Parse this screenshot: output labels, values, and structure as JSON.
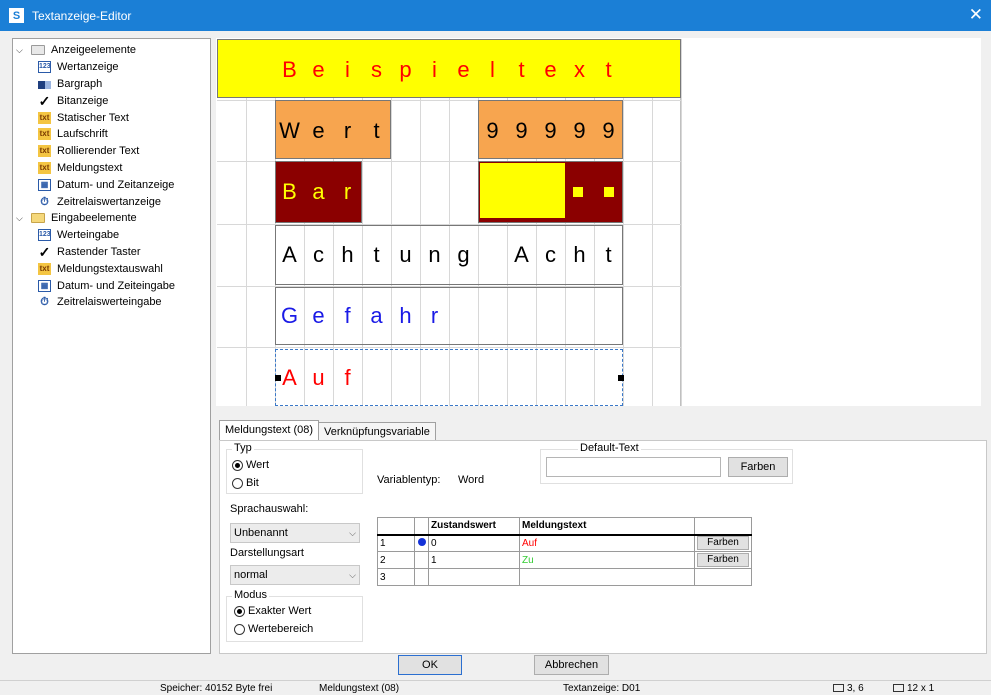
{
  "window": {
    "title": "Textanzeige-Editor",
    "app_icon_letter": "S"
  },
  "tree": {
    "groups": [
      {
        "label": "Anzeigeelemente",
        "items": [
          {
            "label": "Wertanzeige",
            "icon": "value-display-icon"
          },
          {
            "label": "Bargraph",
            "icon": "bargraph-icon"
          },
          {
            "label": "Bitanzeige",
            "icon": "checkmark-icon"
          },
          {
            "label": "Statischer Text",
            "icon": "txt-icon"
          },
          {
            "label": "Laufschrift",
            "icon": "txt-scroll-icon"
          },
          {
            "label": "Rollierender Text",
            "icon": "txt-rolling-icon"
          },
          {
            "label": "Meldungstext",
            "icon": "txt-message-icon"
          },
          {
            "label": "Datum- und Zeitanzeige",
            "icon": "calendar-icon"
          },
          {
            "label": "Zeitrelaiswertanzeige",
            "icon": "timer-icon"
          }
        ]
      },
      {
        "label": "Eingabeelemente",
        "items": [
          {
            "label": "Werteingabe",
            "icon": "value-input-icon"
          },
          {
            "label": "Rastender Taster",
            "icon": "check-input-icon"
          },
          {
            "label": "Meldungstextauswahl",
            "icon": "txt-select-icon"
          },
          {
            "label": "Datum- und Zeiteingabe",
            "icon": "calendar-input-icon"
          },
          {
            "label": "Zeitrelaiswerteingabe",
            "icon": "timer-input-icon"
          }
        ]
      }
    ]
  },
  "preview": {
    "colors": {
      "yellow": "#ffff00",
      "orange": "#f7a54f",
      "darkred": "#8b0000",
      "red": "#ff0000",
      "blue": "#1a1ae6"
    },
    "row1_chars": [
      "B",
      "e",
      "i",
      "s",
      "p",
      "i",
      "e",
      "l",
      "t",
      "e",
      "x",
      "t"
    ],
    "row2_chars_a": [
      "W",
      "e",
      "r",
      "t"
    ],
    "row2_chars_b": [
      "9",
      "9",
      "9",
      "9",
      "9"
    ],
    "row3_chars": [
      "B",
      "a",
      "r"
    ],
    "row4_chars": [
      "A",
      "c",
      "h",
      "t",
      "u",
      "n",
      "g",
      " ",
      "A",
      "c",
      "h",
      "t"
    ],
    "row5_chars": [
      "G",
      "e",
      "f",
      "a",
      "h",
      "r"
    ],
    "row6_chars": [
      "A",
      "u",
      "f"
    ]
  },
  "tabs": [
    {
      "label": "Meldungstext (08)",
      "active": true
    },
    {
      "label": "Verknüpfungsvariable",
      "active": false
    }
  ],
  "form": {
    "typ_label": "Typ",
    "typ_options": [
      {
        "label": "Wert",
        "checked": true
      },
      {
        "label": "Bit",
        "checked": false
      }
    ],
    "sprachauswahl_label": "Sprachauswahl:",
    "sprachauswahl_value": "Unbenannt",
    "darstellungsart_label": "Darstellungsart",
    "darstellungsart_value": "normal",
    "modus_label": "Modus",
    "modus_options": [
      {
        "label": "Exakter Wert",
        "checked": true
      },
      {
        "label": "Wertebereich",
        "checked": false
      }
    ],
    "variablentyp_label": "Variablentyp:",
    "variablentyp_value": "Word",
    "default_text_label": "Default-Text",
    "default_text_value": "",
    "farben_label": "Farben"
  },
  "value_table": {
    "headers": [
      "",
      "",
      "Zustandswert",
      "Meldungstext",
      ""
    ],
    "rows": [
      {
        "num": "1",
        "selected": true,
        "zustandswert": "0",
        "meldungstext": "Auf",
        "text_color": "#ff0000",
        "button": "Farben"
      },
      {
        "num": "2",
        "selected": false,
        "zustandswert": "1",
        "meldungstext": "Zu",
        "text_color": "#33cc33",
        "button": "Farben"
      },
      {
        "num": "3",
        "selected": false,
        "zustandswert": "",
        "meldungstext": "",
        "text_color": "#000000",
        "button": ""
      }
    ]
  },
  "buttons": {
    "ok": "OK",
    "cancel": "Abbrechen"
  },
  "statusbar": {
    "memory": "Speicher: 40152 Byte frei",
    "element": "Meldungstext (08)",
    "display": "Textanzeige: D01",
    "position": "3, 6",
    "size": "12 x 1"
  }
}
